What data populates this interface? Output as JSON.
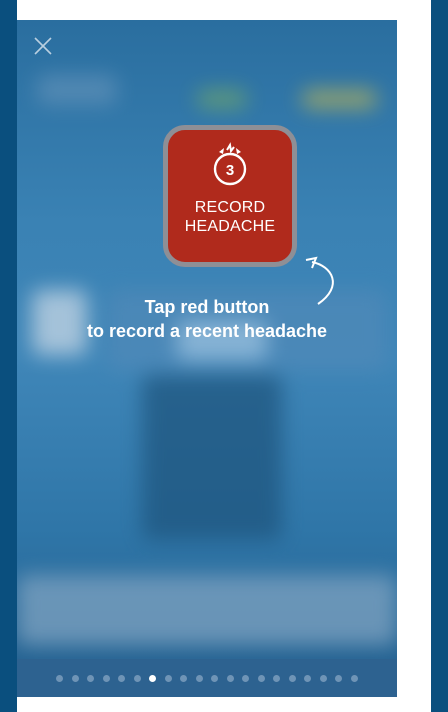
{
  "record_button": {
    "badge_number": "3",
    "label": "RECORD\nHEADACHE"
  },
  "hint": {
    "line1": "Tap red button",
    "line2": "to record a recent headache"
  },
  "pager": {
    "total": 20,
    "current": 6
  },
  "icons": [
    "close-icon",
    "timer-icon",
    "curved-arrow-icon"
  ],
  "colors": {
    "record_red": "#b02a1c",
    "page_border": "#0a4f7e"
  }
}
